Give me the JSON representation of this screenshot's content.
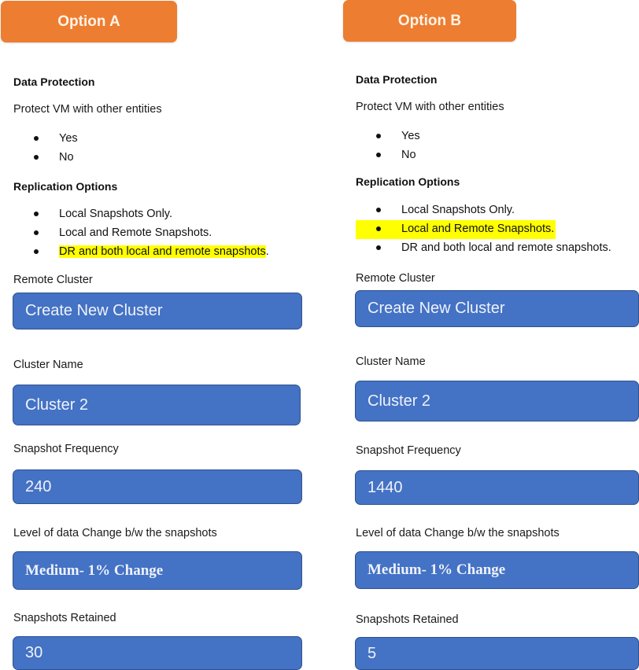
{
  "options": [
    {
      "title": "Option A",
      "data_protection": {
        "heading": "Data Protection",
        "question": "Protect VM with other entities",
        "choices": [
          "Yes",
          "No"
        ]
      },
      "replication": {
        "heading": "Replication Options",
        "choices": [
          "Local Snapshots Only.",
          "Local and Remote Snapshots.",
          "DR and both local and remote snapshots"
        ],
        "choice3_suffix": ".",
        "highlighted_index": 2
      },
      "fields": {
        "remote_cluster_label": "Remote Cluster",
        "remote_cluster_value": "Create New Cluster",
        "cluster_name_label": "Cluster Name",
        "cluster_name_value": "Cluster 2",
        "snapshot_frequency_label": "Snapshot Frequency",
        "snapshot_frequency_value": "240",
        "data_change_label": "Level of data Change b/w the snapshots",
        "data_change_value": "Medium- 1% Change",
        "snapshots_retained_label": "Snapshots Retained",
        "snapshots_retained_value": "30"
      }
    },
    {
      "title": "Option B",
      "data_protection": {
        "heading": "Data Protection",
        "question": "Protect VM with other entities",
        "choices": [
          "Yes",
          "No"
        ]
      },
      "replication": {
        "heading": "Replication Options",
        "choices": [
          "Local Snapshots Only.",
          "Local and Remote Snapshots.",
          "DR and both local and remote snapshots."
        ],
        "highlighted_index": 1
      },
      "fields": {
        "remote_cluster_label": "Remote Cluster",
        "remote_cluster_value": "Create New Cluster",
        "cluster_name_label": "Cluster Name",
        "cluster_name_value": "Cluster 2",
        "snapshot_frequency_label": "Snapshot Frequency",
        "snapshot_frequency_value": "1440",
        "data_change_label": "Level of data Change b/w the snapshots",
        "data_change_value": "Medium- 1% Change",
        "snapshots_retained_label": "Snapshots Retained",
        "snapshots_retained_value": "5"
      }
    }
  ],
  "colors": {
    "option_button": "#ed7d31",
    "field_fill": "#4472c4",
    "highlight": "#ffff00"
  }
}
